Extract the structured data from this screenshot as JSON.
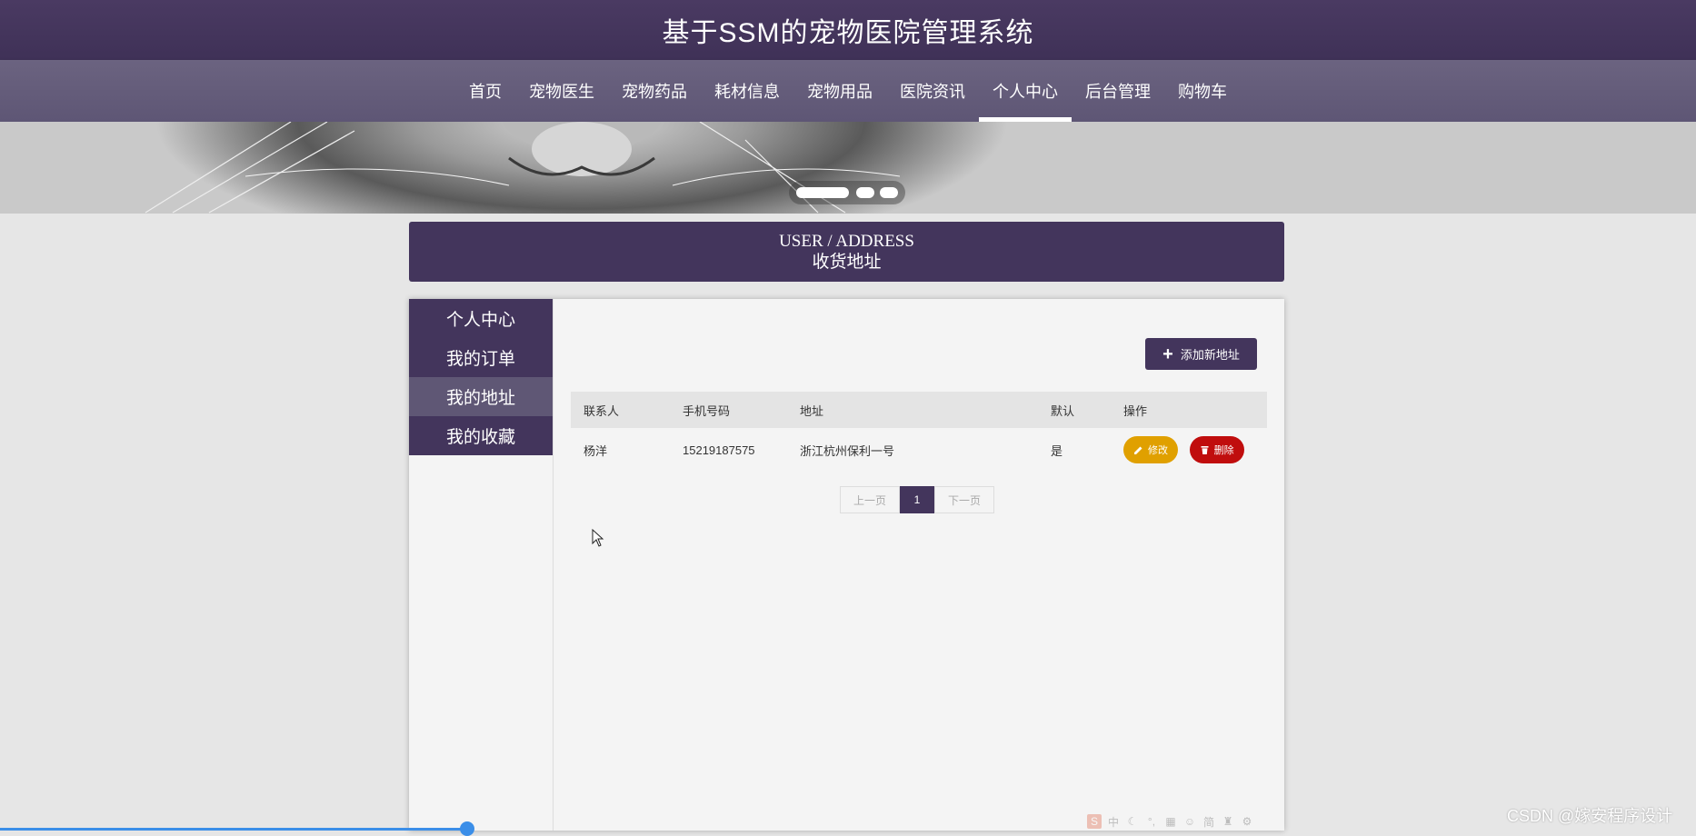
{
  "header": {
    "title": "基于SSM的宠物医院管理系统"
  },
  "nav": {
    "items": [
      {
        "label": "首页"
      },
      {
        "label": "宠物医生"
      },
      {
        "label": "宠物药品"
      },
      {
        "label": "耗材信息"
      },
      {
        "label": "宠物用品"
      },
      {
        "label": "医院资讯"
      },
      {
        "label": "个人中心"
      },
      {
        "label": "后台管理"
      },
      {
        "label": "购物车"
      }
    ],
    "active_index": 6
  },
  "banner": {
    "slide_count": 3,
    "active_slide": 0
  },
  "section": {
    "title_en": "USER / ADDRESS",
    "title_cn": "收货地址"
  },
  "sidebar": {
    "items": [
      {
        "label": "个人中心"
      },
      {
        "label": "我的订单"
      },
      {
        "label": "我的地址"
      },
      {
        "label": "我的收藏"
      }
    ],
    "active_index": 2
  },
  "actions": {
    "add_label": "添加新地址"
  },
  "table": {
    "headers": [
      "联系人",
      "手机号码",
      "地址",
      "默认",
      "操作"
    ],
    "rows": [
      {
        "name": "杨洋",
        "phone": "15219187575",
        "address": "浙江杭州保利一号",
        "default": "是",
        "edit_label": "修改",
        "delete_label": "删除"
      }
    ]
  },
  "pagination": {
    "prev_label": "上一页",
    "current": "1",
    "next_label": "下一页"
  },
  "toolbar": {
    "icons": [
      "logo-icon",
      "chinese-input-icon",
      "moon-icon",
      "punctuation-icon",
      "keyboard-icon",
      "user-icon",
      "simplified-icon",
      "shirt-icon",
      "gear-icon"
    ],
    "labels": [
      "中",
      "简"
    ]
  },
  "watermark": {
    "text": "CSDN @嫁安程序设计"
  },
  "colors": {
    "primary": "#43355c",
    "edit": "#e0a000",
    "delete": "#c00d0d",
    "nav_bg": "#5e5675"
  }
}
